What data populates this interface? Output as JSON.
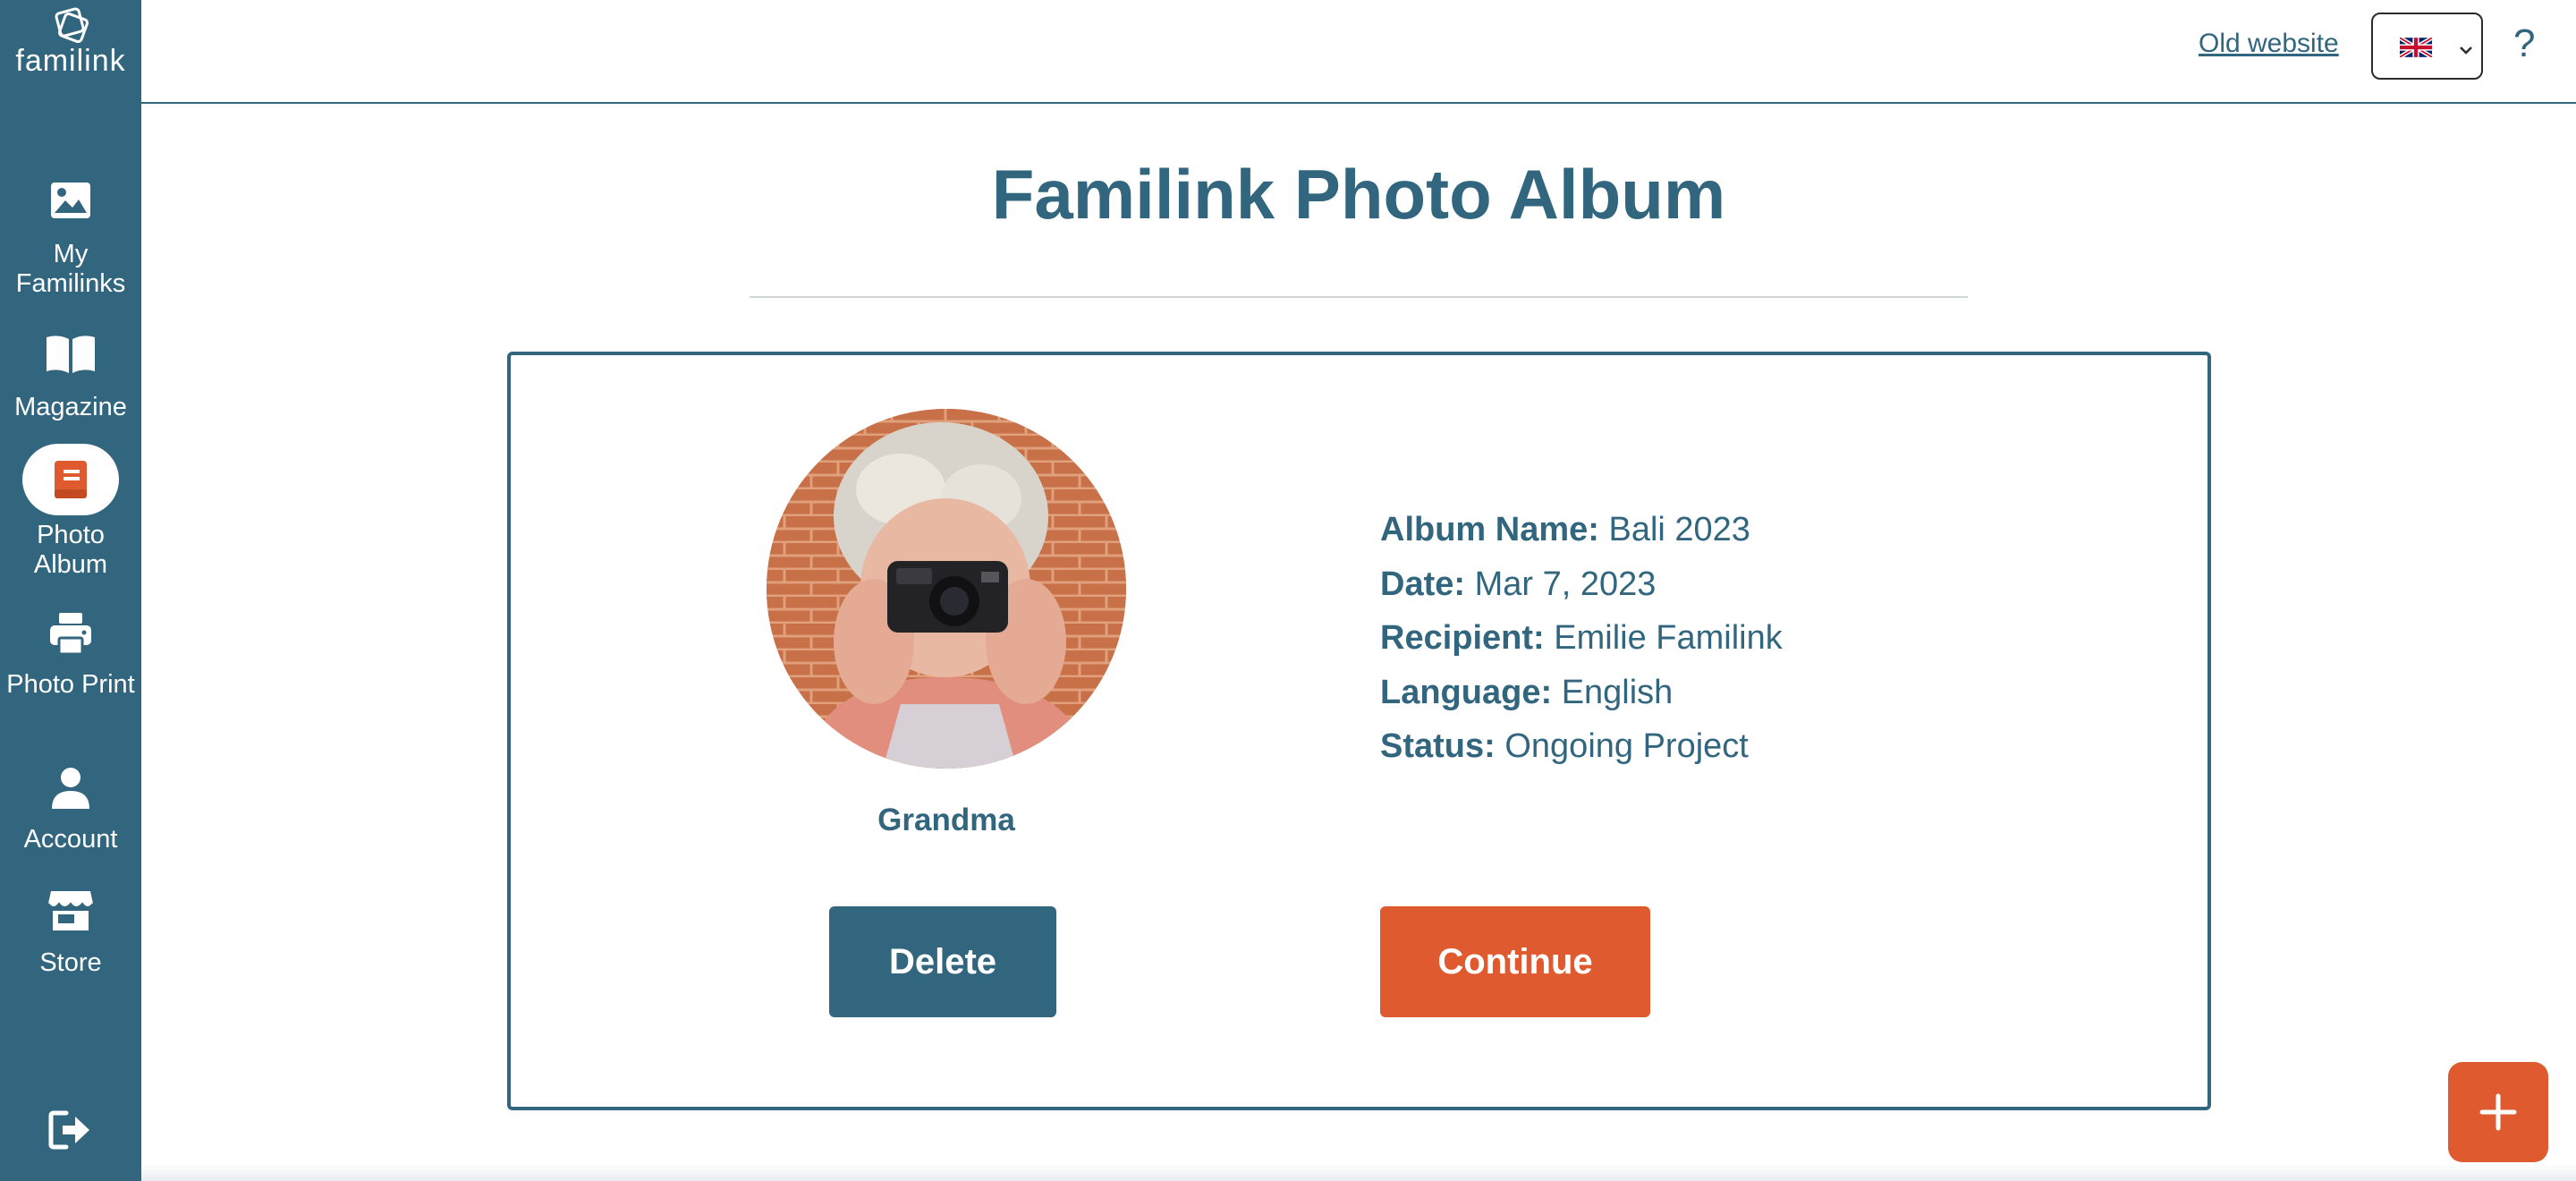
{
  "brand": {
    "logo_text": "familink",
    "primary_color": "#32667f",
    "accent_color": "#df5a2e"
  },
  "sidebar": {
    "items": [
      {
        "label": "My Familinks",
        "icon": "image-icon",
        "active": false
      },
      {
        "label": "Magazine",
        "icon": "open-book-icon",
        "active": false
      },
      {
        "label": "Photo Album",
        "icon": "photo-album-icon",
        "active": true
      },
      {
        "label": "Photo Print",
        "icon": "printer-icon",
        "active": false
      },
      {
        "label": "Account",
        "icon": "user-icon",
        "active": false
      },
      {
        "label": "Store",
        "icon": "store-icon",
        "active": false
      }
    ],
    "logout_icon": "logout-icon"
  },
  "header": {
    "old_website_link": "Old website",
    "language": "English",
    "language_flag": "🇬🇧",
    "help_label": "?"
  },
  "page": {
    "title": "Familink Photo Album"
  },
  "album": {
    "recipient_display_name": "Grandma",
    "details": [
      {
        "label": "Album Name:",
        "value": "Bali 2023"
      },
      {
        "label": "Date:",
        "value": "Mar 7, 2023"
      },
      {
        "label": "Recipient:",
        "value": "Emilie Familink"
      },
      {
        "label": "Language:",
        "value": "English"
      },
      {
        "label": "Status:",
        "value": "Ongoing Project"
      }
    ],
    "delete_label": "Delete",
    "continue_label": "Continue"
  },
  "fab": {
    "icon": "plus-icon"
  }
}
